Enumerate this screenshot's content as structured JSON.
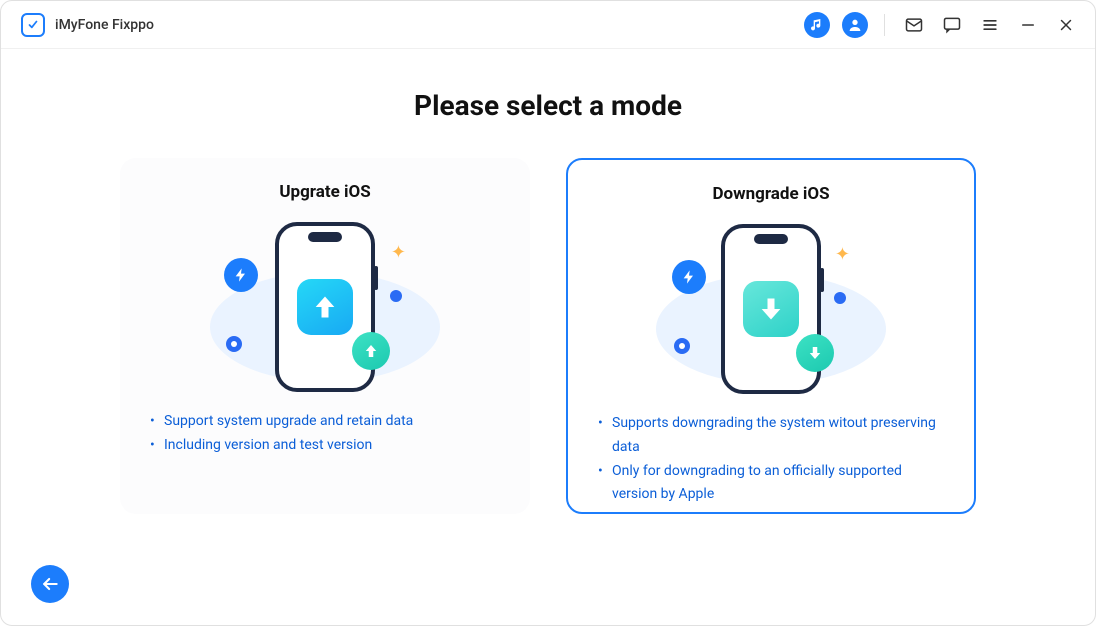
{
  "app": {
    "title": "iMyFone Fixppo"
  },
  "page": {
    "heading": "Please select a mode"
  },
  "cards": [
    {
      "title": "Upgrate iOS",
      "bullets": [
        "Support system upgrade and retain data",
        "Including version and test version"
      ],
      "selected": false
    },
    {
      "title": "Downgrade iOS",
      "bullets": [
        "Supports downgrading the system witout preserving data",
        "Only for downgrading to an officially supported version by Apple"
      ],
      "selected": true
    }
  ]
}
